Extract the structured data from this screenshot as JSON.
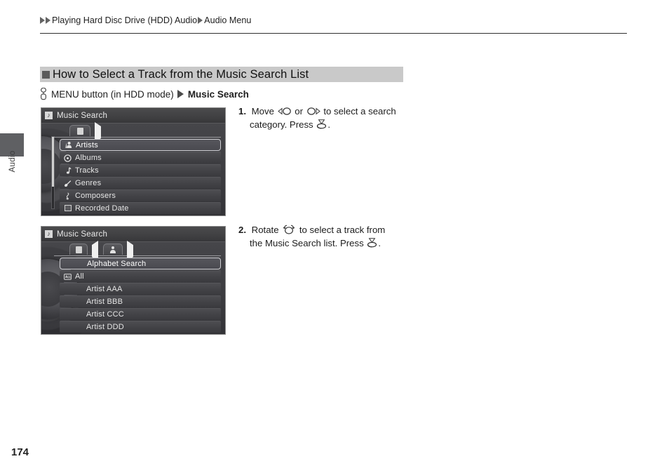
{
  "page": {
    "number": "174",
    "side_tab_label": "Audio"
  },
  "breadcrumb": {
    "items": [
      "Playing Hard Disc Drive (HDD) Audio",
      "Audio Menu"
    ]
  },
  "section": {
    "title": "How to Select a Track from the Music Search List",
    "nav_path": {
      "button_label": "MENU button (in HDD mode)",
      "target": "Music Search"
    }
  },
  "screens": [
    {
      "title": "Music Search",
      "title_icon": "music-note-icon",
      "tabs": [
        {
          "icon": "source-icon",
          "type": "icon"
        },
        {
          "icon": "arrow-right-icon",
          "type": "arrow-right"
        }
      ],
      "items": [
        {
          "label": "Artists",
          "icon": "artist-icon",
          "selected": true
        },
        {
          "label": "Albums",
          "icon": "album-disc-icon",
          "selected": false
        },
        {
          "label": "Tracks",
          "icon": "music-note-icon",
          "selected": false
        },
        {
          "label": "Genres",
          "icon": "guitar-icon",
          "selected": false
        },
        {
          "label": "Composers",
          "icon": "clef-icon",
          "selected": false
        },
        {
          "label": "Recorded Date",
          "icon": "calendar-icon",
          "selected": false
        }
      ]
    },
    {
      "title": "Music Search",
      "title_icon": "music-note-icon",
      "tabs": [
        {
          "icon": "source-icon",
          "type": "icon"
        },
        {
          "icon": "arrow-left-icon",
          "type": "arrow-left"
        },
        {
          "icon": "artist-icon",
          "type": "person"
        },
        {
          "icon": "arrow-right-icon",
          "type": "arrow-right"
        }
      ],
      "items": [
        {
          "label": "Alphabet Search",
          "icon": "none",
          "selected": true
        },
        {
          "label": "All",
          "icon": "all-icon",
          "selected": false
        },
        {
          "label": "Artist AAA",
          "icon": "none",
          "selected": false
        },
        {
          "label": "Artist BBB",
          "icon": "none",
          "selected": false
        },
        {
          "label": "Artist CCC",
          "icon": "none",
          "selected": false
        },
        {
          "label": "Artist DDD",
          "icon": "none",
          "selected": false
        }
      ]
    }
  ],
  "steps": [
    {
      "number": "1.",
      "line1_a": "Move",
      "glyph_left": "left-joystick-icon",
      "line1_b": "or",
      "glyph_right": "right-joystick-icon",
      "line1_c": "to select a search",
      "line2_a": "category. Press",
      "glyph_press": "enter-knob-icon",
      "line2_b": "."
    },
    {
      "number": "2.",
      "line1_a": "Rotate",
      "glyph_rotate": "rotate-knob-icon",
      "line1_b": "to select a track from",
      "line2_a": "the Music Search list. Press",
      "glyph_press": "enter-knob-icon",
      "line2_b": "."
    }
  ],
  "colors": {
    "section_bar": "#c9c9c9",
    "side_tab": "#5f6063",
    "screen_bg": "#3d3d41",
    "rule": "#2f2f2f"
  }
}
